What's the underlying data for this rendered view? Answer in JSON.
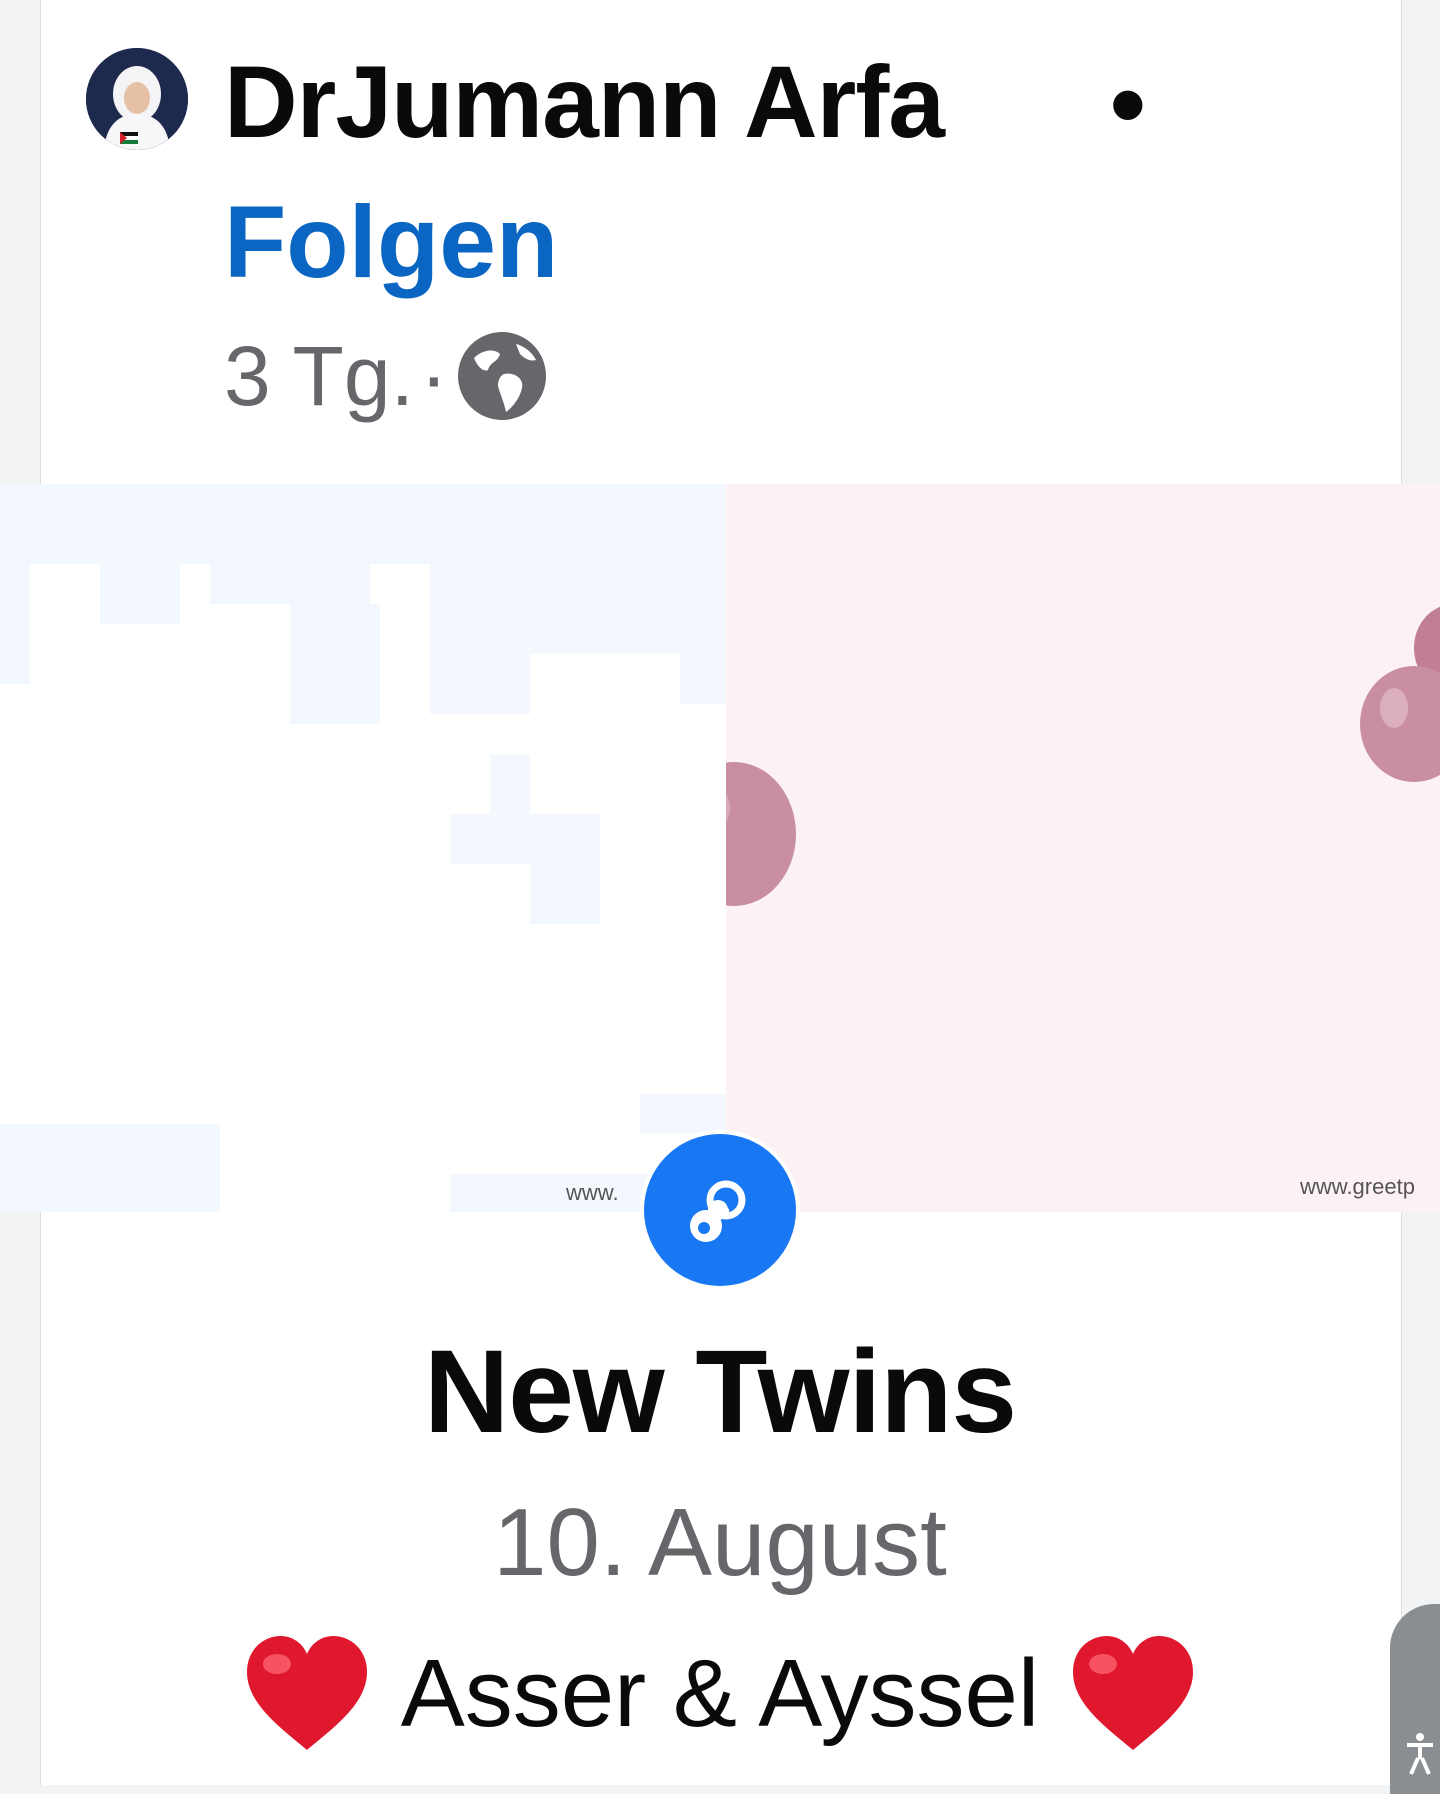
{
  "post": {
    "author": "DrJumann Arfa",
    "separator": "•",
    "follow_label": "Folgen",
    "time": "3 Tg.",
    "time_separator": "·",
    "audience_icon": "globe-icon"
  },
  "banner": {
    "watermark_left": "www.",
    "watermark_right": "www.greetp",
    "badge_icon": "pacifier-icon",
    "accent_color": "#1877f2"
  },
  "event": {
    "title": "New Twins",
    "date": "10. August",
    "names": "Asser & Ayssel",
    "heart_icon": "red-heart-icon"
  },
  "colors": {
    "link": "#0a66c2",
    "secondary_text": "#65676b",
    "balloon": "#c98fa1"
  }
}
